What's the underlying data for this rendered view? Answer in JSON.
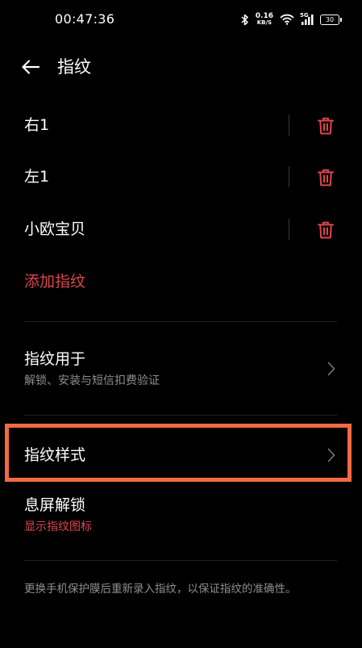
{
  "status_bar": {
    "time": "00:47:36",
    "net_speed_value": "0.16",
    "net_speed_unit": "KB/S",
    "network_type": "5G",
    "battery_level": "30"
  },
  "header": {
    "title": "指纹"
  },
  "fingerprints": [
    {
      "name": "右1"
    },
    {
      "name": "左1"
    },
    {
      "name": "小欧宝贝"
    }
  ],
  "add_fingerprint_label": "添加指纹",
  "settings": {
    "fingerprint_use": {
      "title": "指纹用于",
      "subtitle": "解锁、安装与短信扣费验证"
    },
    "fingerprint_style": {
      "title": "指纹样式"
    },
    "screen_off_unlock": {
      "title": "息屏解锁",
      "subtitle": "显示指纹图标"
    }
  },
  "footer_note": "更换手机保护膜后重新录入指纹，以保证指纹的准确性。",
  "colors": {
    "accent_red": "#e0454c",
    "highlight_orange": "#f16a43",
    "background": "#000000"
  }
}
